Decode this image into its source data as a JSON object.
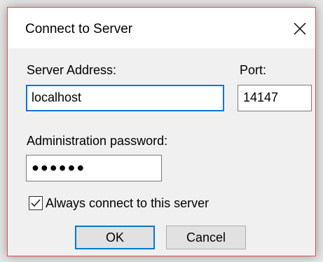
{
  "window": {
    "title": "Connect to Server",
    "close_icon": "close-icon"
  },
  "form": {
    "server_address_label": "Server Address:",
    "server_address_value": "localhost",
    "port_label": "Port:",
    "port_value": "14147",
    "password_label": "Administration password:",
    "password_value_masked": "●●●●●●",
    "always_connect_label": "Always connect to this server",
    "always_connect_checked": true
  },
  "buttons": {
    "ok_label": "OK",
    "cancel_label": "Cancel"
  },
  "colors": {
    "focus_border": "#0078d7",
    "window_border": "#d9534f",
    "dialog_bg": "#f0f0f0",
    "titlebar_bg": "#ffffff"
  }
}
